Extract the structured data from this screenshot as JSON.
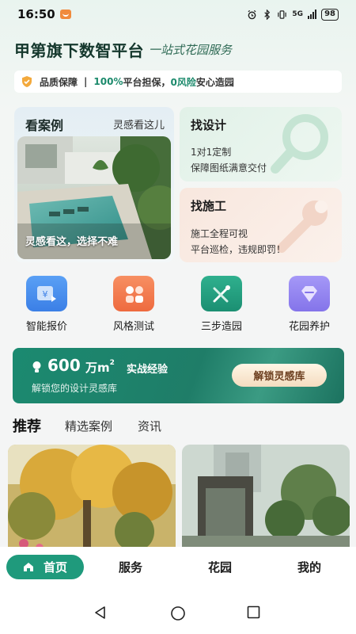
{
  "status_bar": {
    "time": "16:50",
    "network": "5G",
    "battery": "98"
  },
  "header": {
    "title": "甲第旗下数智平台",
    "slogan": "一站式花园服务"
  },
  "guarantee": {
    "label": "品质保障",
    "separator": "|",
    "part1_highlight": "100%",
    "part1_text": "平台担保，",
    "part2_highlight": "0风险",
    "part2_text": "安心造园"
  },
  "case_card": {
    "title": "看案例",
    "subtitle": "灵感看这儿",
    "caption": "灵感看这，选择不难"
  },
  "design_card": {
    "title": "找设计",
    "line1": "1对1定制",
    "line2": "保障图纸满意交付"
  },
  "build_card": {
    "title": "找施工",
    "line1": "施工全程可视",
    "line2": "平台巡检，违规即罚！"
  },
  "quick_actions": [
    {
      "label": "智能报价",
      "icon": "price-tag-icon",
      "color": "#4a8ff0"
    },
    {
      "label": "风格测试",
      "icon": "style-test-icon",
      "color": "#f3784f"
    },
    {
      "label": "三步造园",
      "icon": "tools-icon",
      "color": "#1f9a7c"
    },
    {
      "label": "花园养护",
      "icon": "gem-icon",
      "color": "#8f7ff0"
    }
  ],
  "banner": {
    "number": "600",
    "unit": "万m",
    "unit_sup": "2",
    "experience": "实战经验",
    "subtitle": "解锁您的设计灵感库",
    "cta": "解锁灵感库"
  },
  "tabs": [
    {
      "label": "推荐",
      "active": true
    },
    {
      "label": "精选案例",
      "active": false
    },
    {
      "label": "资讯",
      "active": false
    }
  ],
  "bottom_nav": {
    "home": "首页",
    "service": "服务",
    "garden": "花园",
    "mine": "我的"
  },
  "colors": {
    "accent": "#1f9a7c",
    "banner": "#1b8a70",
    "cta_text": "#6b3d1d"
  }
}
